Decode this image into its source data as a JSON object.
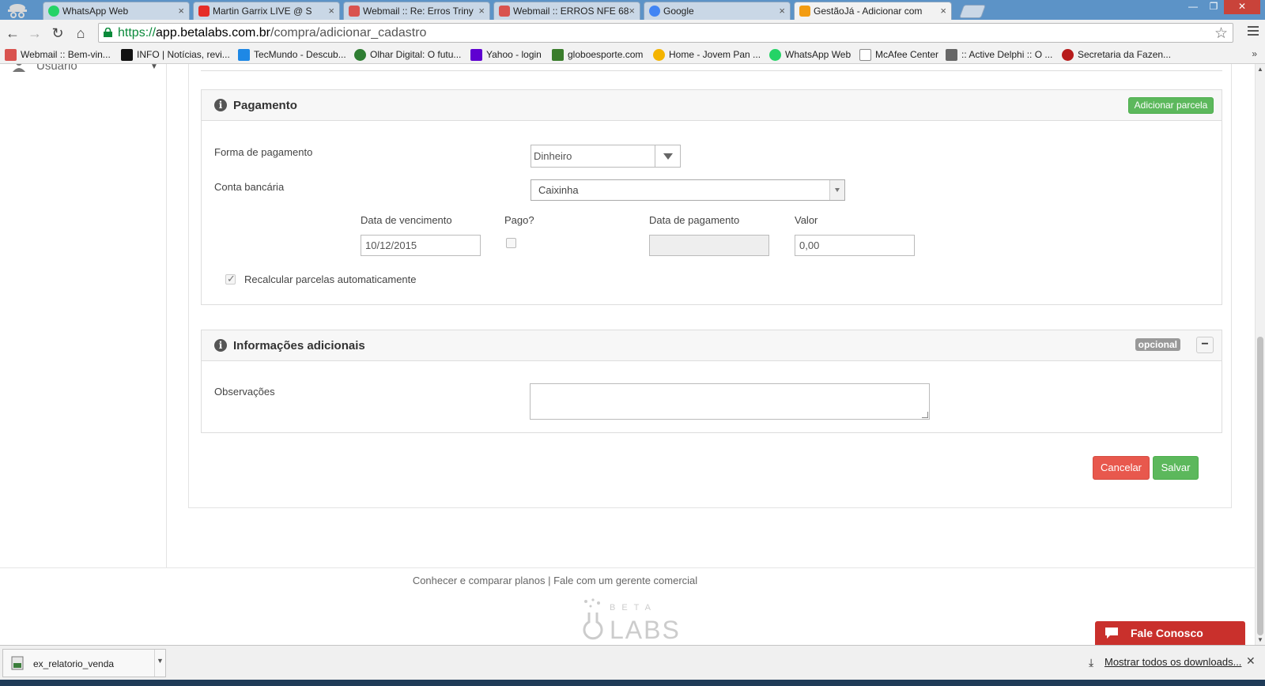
{
  "browser": {
    "tabs": [
      {
        "label": "WhatsApp Web",
        "color": "#25d366"
      },
      {
        "label": "Martin Garrix LIVE @ S",
        "color": "#e52d27"
      },
      {
        "label": "Webmail :: Re: Erros Triny",
        "color": "#d9534f"
      },
      {
        "label": "Webmail :: ERROS NFE 68",
        "color": "#d9534f"
      },
      {
        "label": "Google",
        "color": "#4285f4"
      },
      {
        "label": "GestãoJá - Adicionar com",
        "color": "#f39c12"
      }
    ],
    "url_scheme": "https://",
    "url_host": "app.betalabs.com.br",
    "url_path": "/compra/adicionar_cadastro",
    "bookmarks": [
      {
        "label": "Webmail :: Bem-vin...",
        "color": "#d9534f"
      },
      {
        "label": "INFO | Notícias, revi...",
        "color": "#111111"
      },
      {
        "label": "TecMundo - Descub...",
        "color": "#1e88e5"
      },
      {
        "label": "Olhar Digital: O futu...",
        "color": "#2e7d32"
      },
      {
        "label": "Yahoo - login",
        "color": "#5f01d1"
      },
      {
        "label": "globoesporte.com",
        "color": "#3a7d2c"
      },
      {
        "label": "Home - Jovem Pan ...",
        "color": "#f4b400"
      },
      {
        "label": "WhatsApp Web",
        "color": "#25d366"
      },
      {
        "label": "McAfee Center",
        "color": "#888888"
      },
      {
        "label": ":: Active Delphi :: O ...",
        "color": "#666666"
      },
      {
        "label": "Secretaria da Fazen...",
        "color": "#b71c1c"
      }
    ]
  },
  "sidebar": {
    "user_label": "Usuário"
  },
  "payment": {
    "title": "Pagamento",
    "add_installment": "Adicionar parcela",
    "payment_method_label": "Forma de pagamento",
    "payment_method_value": "Dinheiro",
    "bank_account_label": "Conta bancária",
    "bank_account_value": "Caixinha",
    "due_date_label": "Data de vencimento",
    "due_date_value": "10/12/2015",
    "paid_label": "Pago?",
    "payment_date_label": "Data de pagamento",
    "amount_label": "Valor",
    "amount_value": "0,00",
    "recalc_label": "Recalcular parcelas automaticamente"
  },
  "additional": {
    "title": "Informações adicionais",
    "optional_badge": "opcional",
    "collapse_symbol": "−",
    "notes_label": "Observações"
  },
  "actions": {
    "cancel": "Cancelar",
    "save": "Salvar"
  },
  "footer": {
    "plans_link": "Conhecer e comparar planos",
    "separator": "|",
    "contact_link": "Fale com um gerente comercial",
    "logo_top": "BETA",
    "logo_bottom": "LABS",
    "chat_label": "Fale Conosco"
  },
  "downloads": {
    "file_name": "ex_relatorio_venda",
    "show_all": "Mostrar todos os downloads..."
  },
  "colors": {
    "green": "#5cb85c",
    "red": "#e8584d",
    "chat": "#c9302c"
  }
}
